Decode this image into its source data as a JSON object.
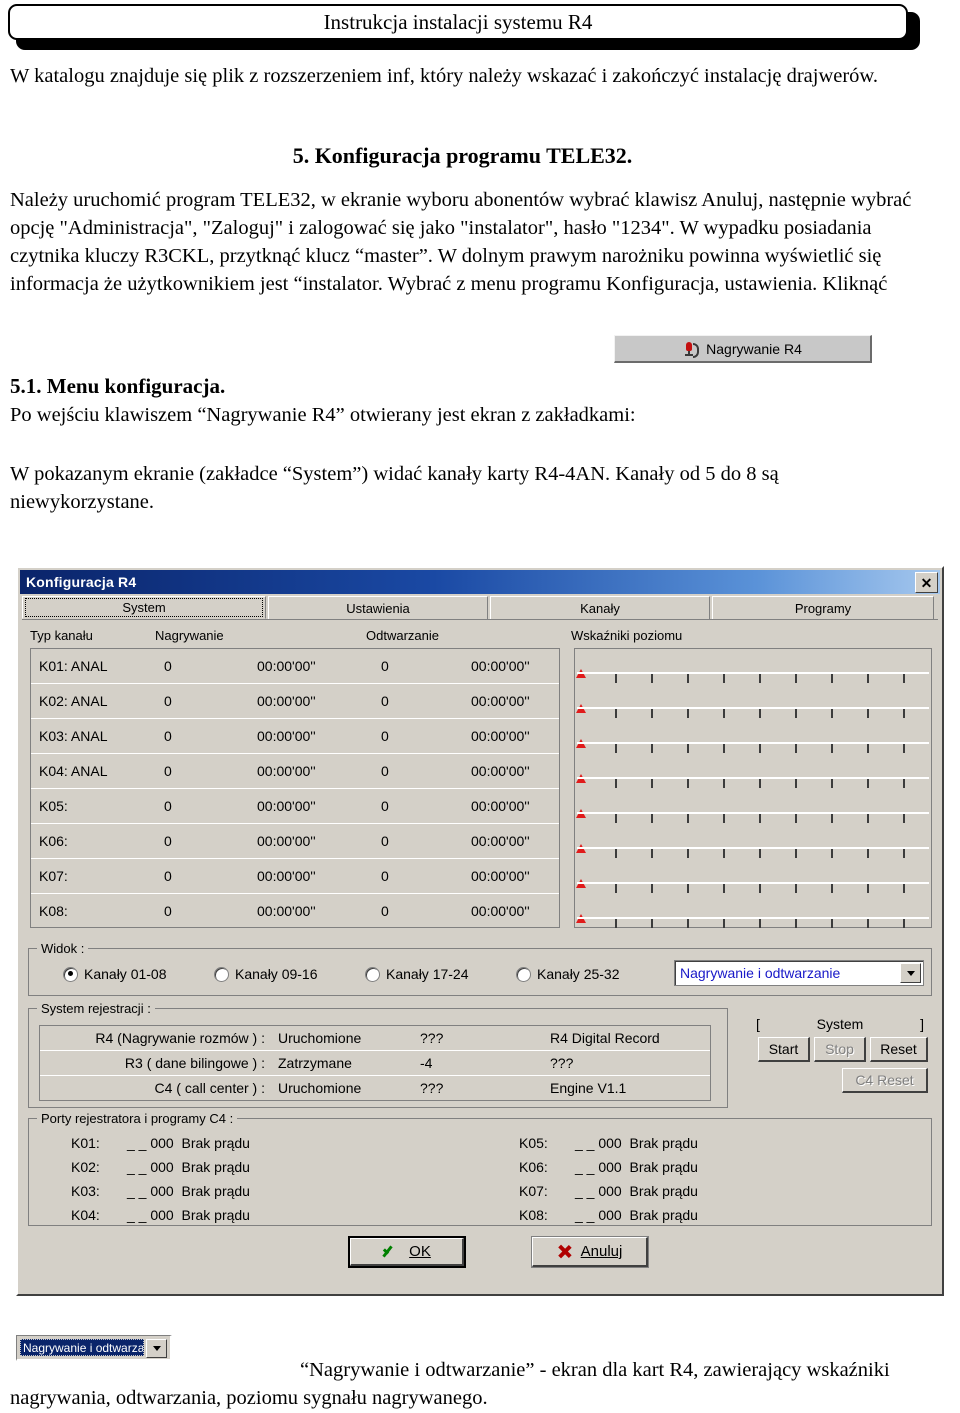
{
  "header": {
    "title": "Instrukcja instalacji systemu R4"
  },
  "prose": {
    "p1": "W katalogu znajduje się plik z rozszerzeniem inf, który należy wskazać i zakończyć instalację drajwerów.",
    "section5": "5. Konfiguracja programu TELE32.",
    "p2": "Należy uruchomić program TELE32, w ekranie wyboru abonentów wybrać klawisz Anuluj, następnie wybrać opcję \"Administracja\", \"Zaloguj\" i zalogować się jako \"instalator\", hasło \"1234\". W wypadku posiadania czytnika kluczy R3CKL, przytknąć klucz “master”. W dolnym prawym narożniku powinna wyświetlić się informacja że użytkownikiem jest “instalator. Wybrać z menu programu Konfiguracja, ustawienia. Kliknąć",
    "section51": "5.1. Menu konfiguracja.",
    "p4": "Po wejściu klawiszem “Nagrywanie R4” otwierany jest ekran z zakładkami:",
    "p5": "W pokazanym ekranie (zakładce “System”) widać kanały karty R4-4AN. Kanały od 5 do 8 są niewykorzystane.",
    "rec_button_label": "Nagrywanie R4"
  },
  "dialog": {
    "title": "Konfiguracja R4",
    "close_label": "✕",
    "tabs": [
      {
        "label": "System",
        "active": true
      },
      {
        "label": "Ustawienia",
        "active": false
      },
      {
        "label": "Kanały",
        "active": false
      },
      {
        "label": "Programy",
        "active": false
      }
    ],
    "column_headers": [
      "Typ kanału",
      "Nagrywanie",
      "Odtwarzanie",
      "Wskaźniki poziomu"
    ],
    "channels": [
      {
        "name": "K01: ANAL",
        "rec_count": "0",
        "rec_time": "00:00'00''",
        "play_count": "0",
        "play_time": "00:00'00''"
      },
      {
        "name": "K02: ANAL",
        "rec_count": "0",
        "rec_time": "00:00'00''",
        "play_count": "0",
        "play_time": "00:00'00''"
      },
      {
        "name": "K03: ANAL",
        "rec_count": "0",
        "rec_time": "00:00'00''",
        "play_count": "0",
        "play_time": "00:00'00''"
      },
      {
        "name": "K04: ANAL",
        "rec_count": "0",
        "rec_time": "00:00'00''",
        "play_count": "0",
        "play_time": "00:00'00''"
      },
      {
        "name": "K05:",
        "rec_count": "0",
        "rec_time": "00:00'00''",
        "play_count": "0",
        "play_time": "00:00'00''"
      },
      {
        "name": "K06:",
        "rec_count": "0",
        "rec_time": "00:00'00''",
        "play_count": "0",
        "play_time": "00:00'00''"
      },
      {
        "name": "K07:",
        "rec_count": "0",
        "rec_time": "00:00'00''",
        "play_count": "0",
        "play_time": "00:00'00''"
      },
      {
        "name": "K08:",
        "rec_count": "0",
        "rec_time": "00:00'00''",
        "play_count": "0",
        "play_time": "00:00'00''"
      }
    ],
    "widok": {
      "legend": "Widok :",
      "options": [
        {
          "label": "Kanały 01-08",
          "checked": true
        },
        {
          "label": "Kanały 09-16",
          "checked": false
        },
        {
          "label": "Kanały 17-24",
          "checked": false
        },
        {
          "label": "Kanały 25-32",
          "checked": false
        }
      ],
      "combo_value": "Nagrywanie i odtwarzanie"
    },
    "system_rejestracji": {
      "legend": "System rejestracji :",
      "rows": [
        {
          "label": "R4 (Nagrywanie rozmów ) :",
          "state": "Uruchomione",
          "code": "???",
          "info": "R4 Digital Record"
        },
        {
          "label": "R3 ( dane bilingowe ) :",
          "state": "Zatrzymane",
          "code": "-4",
          "info": "???"
        },
        {
          "label": "C4 ( call center ) :",
          "state": "Uruchomione",
          "code": "???",
          "info": "Engine V1.1"
        }
      ]
    },
    "system_panel": {
      "bracket_left": "[",
      "title": "System",
      "bracket_right": "]",
      "buttons": [
        {
          "label": "Start",
          "disabled": false
        },
        {
          "label": "Stop",
          "disabled": true
        },
        {
          "label": "Reset",
          "disabled": false
        },
        {
          "label": "C4 Reset",
          "disabled": true
        }
      ]
    },
    "ports": {
      "legend": "Porty rejestratora i programy C4 :",
      "left": [
        {
          "key": "K01:",
          "value": "_ _ 000  Brak prądu"
        },
        {
          "key": "K02:",
          "value": "_ _ 000  Brak prądu"
        },
        {
          "key": "K03:",
          "value": "_ _ 000  Brak prądu"
        },
        {
          "key": "K04:",
          "value": "_ _ 000  Brak prądu"
        }
      ],
      "right": [
        {
          "key": "K05:",
          "value": "_ _ 000  Brak prądu"
        },
        {
          "key": "K06:",
          "value": "_ _ 000  Brak prądu"
        },
        {
          "key": "K07:",
          "value": "_ _ 000  Brak prądu"
        },
        {
          "key": "K08:",
          "value": "_ _ 000  Brak prądu"
        }
      ]
    },
    "footer": {
      "ok_label": "OK",
      "cancel_label": "Anuluj"
    }
  },
  "bottom": {
    "combo_value": "Nagrywanie i odtwarzanie",
    "caption": "“Nagrywanie i odtwarzanie” - ekran dla kart R4, zawierający wskaźniki nagrywania, odtwarzania, poziomu sygnału nagrywanego."
  },
  "colors": {
    "titlebar_start": "#0a246a",
    "titlebar_end": "#a6c8ee",
    "dialog_face": "#d4d0c8",
    "combo_text": "#1818c8",
    "meter_marker": "#e01b1b",
    "ok_check": "#008000",
    "cancel_x": "#b00000"
  }
}
